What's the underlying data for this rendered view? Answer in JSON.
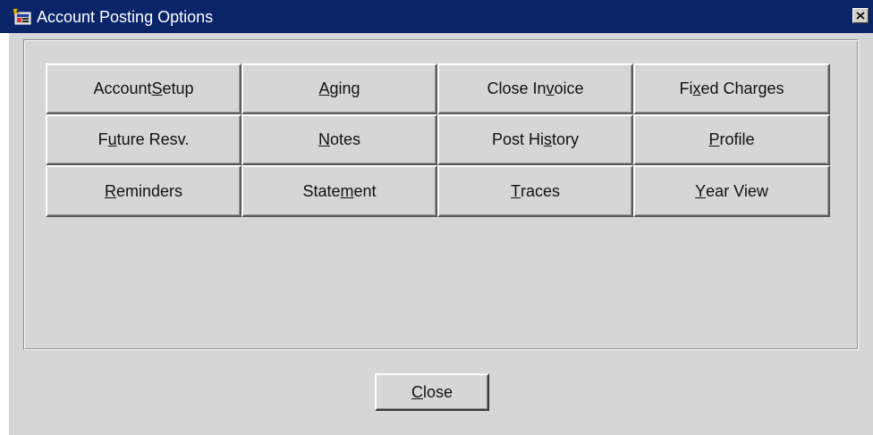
{
  "window": {
    "title": "Account Posting Options",
    "title_icon": "app-icon",
    "close_icon": "close-icon"
  },
  "colors": {
    "titlebar": "#0a246a",
    "window_bg": "#d6d6d6",
    "title_text": "#ffffff"
  },
  "options": [
    {
      "id": "account-setup",
      "before": "Account ",
      "mnemonic": "S",
      "after": "etup"
    },
    {
      "id": "aging",
      "before": "",
      "mnemonic": "A",
      "after": "ging"
    },
    {
      "id": "close-invoice",
      "before": "Close In",
      "mnemonic": "v",
      "after": "oice"
    },
    {
      "id": "fixed-charges",
      "before": "Fi",
      "mnemonic": "x",
      "after": "ed Charges"
    },
    {
      "id": "future-resv",
      "before": "F",
      "mnemonic": "u",
      "after": "ture Resv."
    },
    {
      "id": "notes",
      "before": "",
      "mnemonic": "N",
      "after": "otes"
    },
    {
      "id": "post-history",
      "before": "Post Hi",
      "mnemonic": "s",
      "after": "tory"
    },
    {
      "id": "profile",
      "before": "",
      "mnemonic": "P",
      "after": "rofile"
    },
    {
      "id": "reminders",
      "before": "",
      "mnemonic": "R",
      "after": "eminders"
    },
    {
      "id": "statement",
      "before": "State",
      "mnemonic": "m",
      "after": "ent"
    },
    {
      "id": "traces",
      "before": "",
      "mnemonic": "T",
      "after": "races"
    },
    {
      "id": "year-view",
      "before": "",
      "mnemonic": "Y",
      "after": "ear View"
    }
  ],
  "footer": {
    "close_before": "",
    "close_mnemonic": "C",
    "close_after": "lose"
  }
}
